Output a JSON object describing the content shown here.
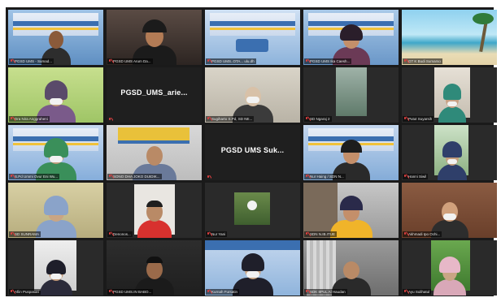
{
  "meeting": {
    "tiles": [
      {
        "name": "PGSD UMS - Sumad...",
        "type": "video"
      },
      {
        "name": "PGSD UMS Arum Da...",
        "type": "video"
      },
      {
        "name": "PGSD UMS..OTA... ulu.dh",
        "type": "video"
      },
      {
        "name": "PGSD UMS Ika Caesh...",
        "type": "video"
      },
      {
        "name": "GT K Budi Sumarso",
        "type": "video"
      },
      {
        "name": "Dra Nira Anggraheni",
        "type": "video"
      },
      {
        "name": "PGSD_UMS_arie...",
        "type": "name-only"
      },
      {
        "name": "Sugiharto S.Pd, SD NE...",
        "type": "video"
      },
      {
        "name": "SD Ngaraj 2",
        "type": "video"
      },
      {
        "name": "Putut Suyarsih",
        "type": "video"
      },
      {
        "name": "S.Pd Ummi Ovur Eni Wu...",
        "type": "video"
      },
      {
        "name": "SONO DHA JOKO DUIDIK...",
        "type": "video"
      },
      {
        "name": "PGSD UMS Suk...",
        "type": "name-only"
      },
      {
        "name": "Nur Haing / SDN N...",
        "type": "video"
      },
      {
        "name": "Hanni Siwil",
        "type": "video"
      },
      {
        "name": "SD SUNRAMA",
        "type": "video"
      },
      {
        "name": "Denonos...",
        "type": "video"
      },
      {
        "name": "Nur Yani",
        "type": "video"
      },
      {
        "name": "SDN N.IB.ITUE",
        "type": "video"
      },
      {
        "name": "Akhmadi Ipo Ochi...",
        "type": "video"
      },
      {
        "name": "Afiin Puspasari",
        "type": "video"
      },
      {
        "name": "PGSD UMS.IN BABO...",
        "type": "video"
      },
      {
        "name": "Kurnah Fursatin",
        "type": "video"
      },
      {
        "name": "SDK 8PUL Al Haudan",
        "type": "video"
      },
      {
        "name": "Ayu Sulihatul",
        "type": "video"
      }
    ]
  }
}
